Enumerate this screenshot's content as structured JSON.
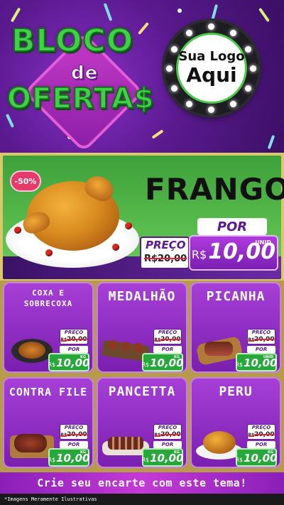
{
  "header": {
    "title_bloco": "BLOCO",
    "title_de": "de",
    "title_ofertas": "OFERTA$",
    "logo_line1": "Sua Logo",
    "logo_line2": "Aqui"
  },
  "featured": {
    "discount": "-50%",
    "name": "FRANGO",
    "preco_label": "PREÇO",
    "old_price": "R$20,00",
    "por_label": "POR",
    "currency": "R$",
    "new_price": "10,00",
    "unit": "UNID"
  },
  "products": [
    {
      "name": "COXA E SOBRECOXA",
      "preco_label": "PREÇO",
      "old_price": "20,00",
      "old_currency": "R$",
      "por_label": "POR",
      "currency": "R$",
      "price": "10,00",
      "unit": "KG"
    },
    {
      "name": "MEDALHÃO",
      "preco_label": "PREÇO",
      "old_price": "20,00",
      "old_currency": "R$",
      "por_label": "POR",
      "currency": "R$",
      "price": "10,00",
      "unit": "KG"
    },
    {
      "name": "PICANHA",
      "preco_label": "PREÇO",
      "old_price": "20,00",
      "old_currency": "R$",
      "por_label": "POR",
      "currency": "R$",
      "price": "10,00",
      "unit": "UNID"
    },
    {
      "name": "CONTRA FILE",
      "preco_label": "PREÇO",
      "old_price": "20,00",
      "old_currency": "R$",
      "por_label": "POR",
      "currency": "R$",
      "price": "10,00",
      "unit": "KG"
    },
    {
      "name": "PANCETTA",
      "preco_label": "PREÇO",
      "old_price": "20,00",
      "old_currency": "R$",
      "por_label": "POR",
      "currency": "R$",
      "price": "10,00",
      "unit": "KG"
    },
    {
      "name": "PERU",
      "preco_label": "PREÇO",
      "old_price": "20,00",
      "old_currency": "R$",
      "por_label": "POR",
      "currency": "R$",
      "price": "10,00",
      "unit": "KG"
    }
  ],
  "footer": {
    "cta": "Crie seu encarte com este tema!",
    "disclaimer": "*Imagens Meramente Ilustrativas"
  },
  "colors": {
    "purple": "#7a1fb0",
    "green": "#27a83a",
    "title_green": "#3fd14a",
    "strike_red": "#e6223a"
  }
}
